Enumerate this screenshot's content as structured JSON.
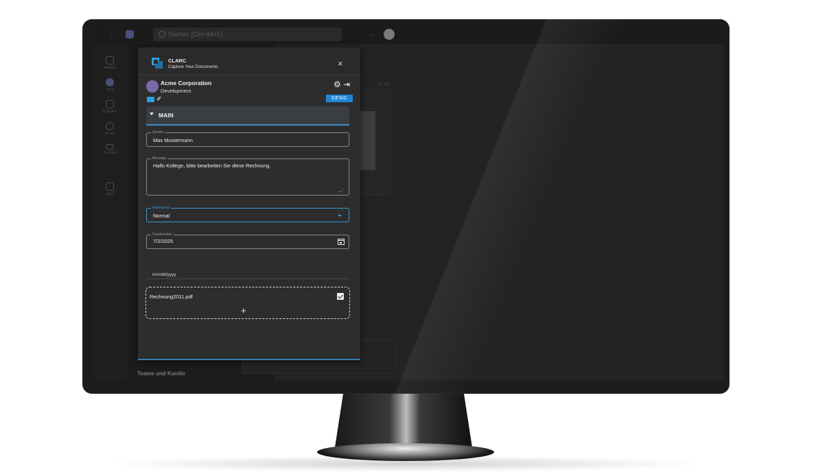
{
  "teams": {
    "search_placeholder": "Suchen (Ctrl+Alt+E)",
    "nav": [
      "Aktivität",
      "Chat",
      "Kalender",
      "Anrufe",
      "OneDrive",
      "Apps"
    ],
    "more": "...",
    "top_more": "...",
    "message_time": "11:52",
    "footer": "Teams und Kanäle"
  },
  "dialog": {
    "brand": "CLARC",
    "tagline": "Capture Your Documents",
    "close_icon": "×",
    "org_name": "Acme Corporation",
    "org_dept": "Development",
    "send_label": "SEND",
    "section_label": "MAIN",
    "fields": {
      "sender": {
        "label": "Sender",
        "value": "Max Mustermann"
      },
      "message": {
        "label": "Message",
        "value": "Hallo Kollege, bitte bearbeiten Sie diese Rechnung."
      },
      "importance": {
        "label": "Importance",
        "value": "Normal"
      },
      "creationdate": {
        "label": "Creationdate",
        "value": "7/2/2025",
        "hint": "mm/dd/yyyy"
      }
    },
    "attachment": {
      "file_name": "Rechnung2011.pdf",
      "checked": true,
      "add_icon": "+"
    }
  },
  "colors": {
    "accent": "#1e88d6",
    "focus": "#3a9ad9",
    "dialog_bg": "#2d2d2d",
    "screen_bg": "#202020"
  },
  "icons": [
    "search-icon",
    "gear-icon",
    "logout-icon",
    "close-icon",
    "folder-icon",
    "eraser-icon",
    "calendar-icon",
    "checkbox-icon",
    "plus-icon",
    "chevron-down-icon"
  ]
}
